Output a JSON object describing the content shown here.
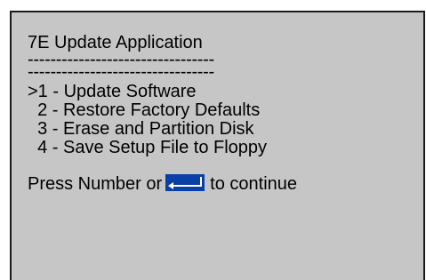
{
  "screen": {
    "title": "7E Update Application",
    "rule_line_1": "---------------------------------",
    "rule_line_2": "---------------------------------",
    "menu": {
      "items": [
        {
          "text": ">1 - Update Software"
        },
        {
          "text": "  2 - Restore Factory Defaults"
        },
        {
          "text": "  3 - Erase and Partition Disk"
        },
        {
          "text": "  4 - Save Setup File to Floppy"
        }
      ]
    },
    "prompt": {
      "before": "Press Number or",
      "after": "to continue",
      "enter_icon": "enter-key-icon"
    }
  },
  "colors": {
    "panel_background": "#c6c6c6",
    "text": "#000000",
    "enter_key_background": "#0b3fa8",
    "enter_key_arrow": "#ffffff"
  }
}
